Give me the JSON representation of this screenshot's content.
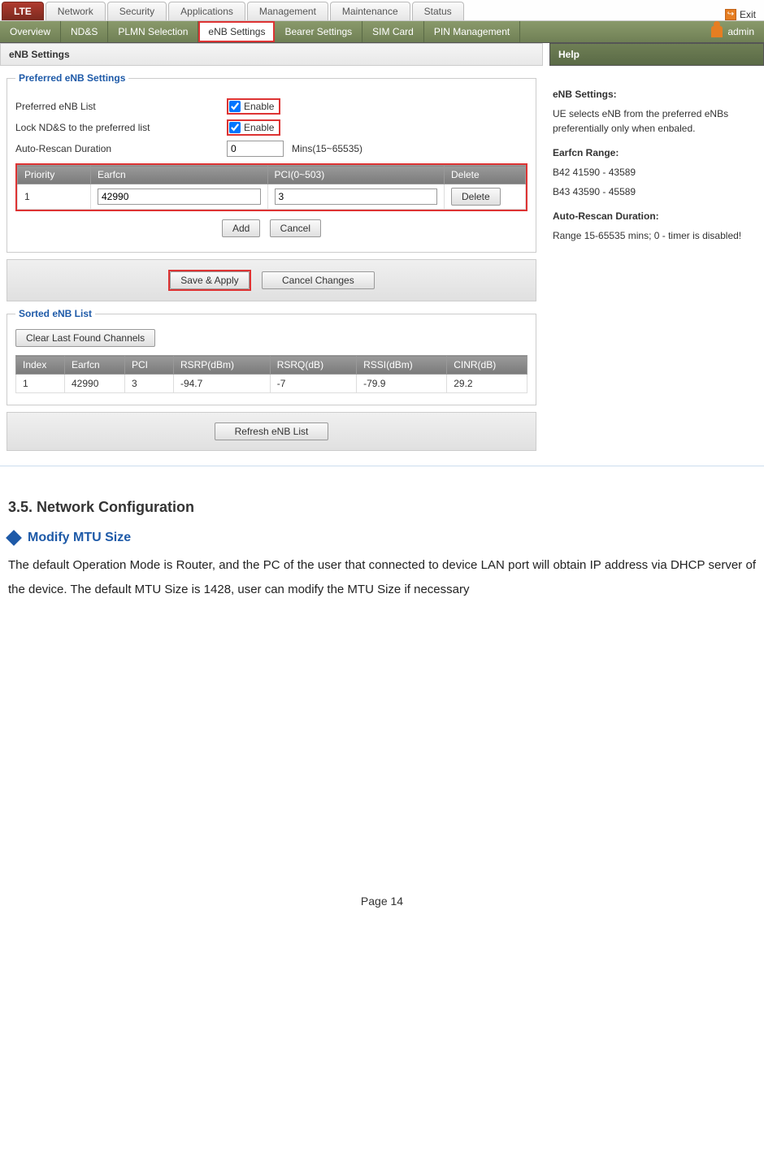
{
  "top_tabs": {
    "items": [
      "LTE",
      "Network",
      "Security",
      "Applications",
      "Management",
      "Maintenance",
      "Status"
    ],
    "active": "LTE",
    "exit_label": "Exit"
  },
  "sub_tabs": {
    "items": [
      "Overview",
      "ND&S",
      "PLMN Selection",
      "eNB Settings",
      "Bearer Settings",
      "SIM Card",
      "PIN Management"
    ],
    "active": "eNB Settings",
    "user": "admin"
  },
  "panel": {
    "title": "eNB Settings",
    "preferred": {
      "legend": "Preferred eNB Settings",
      "rows": {
        "pref_list_label": "Preferred eNB List",
        "lock_label": "Lock ND&S to the preferred list",
        "auto_label": "Auto-Rescan Duration",
        "enable_text": "Enable",
        "duration_value": "0",
        "duration_hint": "Mins(15~65535)"
      },
      "table": {
        "headers": [
          "Priority",
          "Earfcn",
          "PCI(0~503)",
          "Delete"
        ],
        "row": {
          "priority": "1",
          "earfcn": "42990",
          "pci": "3",
          "delete_btn": "Delete"
        }
      },
      "add_btn": "Add",
      "cancel_btn": "Cancel"
    },
    "actions": {
      "save": "Save & Apply",
      "cancel": "Cancel Changes"
    },
    "sorted": {
      "legend": "Sorted eNB List",
      "clear_btn": "Clear Last Found Channels",
      "headers": [
        "Index",
        "Earfcn",
        "PCI",
        "RSRP(dBm)",
        "RSRQ(dB)",
        "RSSI(dBm)",
        "CINR(dB)"
      ],
      "row": {
        "index": "1",
        "earfcn": "42990",
        "pci": "3",
        "rsrp": "-94.7",
        "rsrq": "-7",
        "rssi": "-79.9",
        "cinr": "29.2"
      },
      "refresh_btn": "Refresh eNB List"
    }
  },
  "help": {
    "title": "Help",
    "s1_label": "eNB Settings:",
    "s1_body": "UE selects eNB from the preferred eNBs preferentially only when enbaled.",
    "s2_label": "Earfcn Range:",
    "s2_line1": "B42 41590 - 43589",
    "s2_line2": "B43 43590 - 45589",
    "s3_label": "Auto-Rescan Duration:",
    "s3_body": "Range 15-65535 mins; 0 - timer is disabled!"
  },
  "doc": {
    "heading": "3.5.    Network Configuration",
    "subheading": "Modify MTU Size",
    "body": "The default Operation Mode is Router, and the PC of the user that connected to device LAN port will obtain IP address via DHCP server of the device. The default MTU Size is 1428, user can modify the MTU Size if necessary",
    "footer": "Page 14"
  }
}
